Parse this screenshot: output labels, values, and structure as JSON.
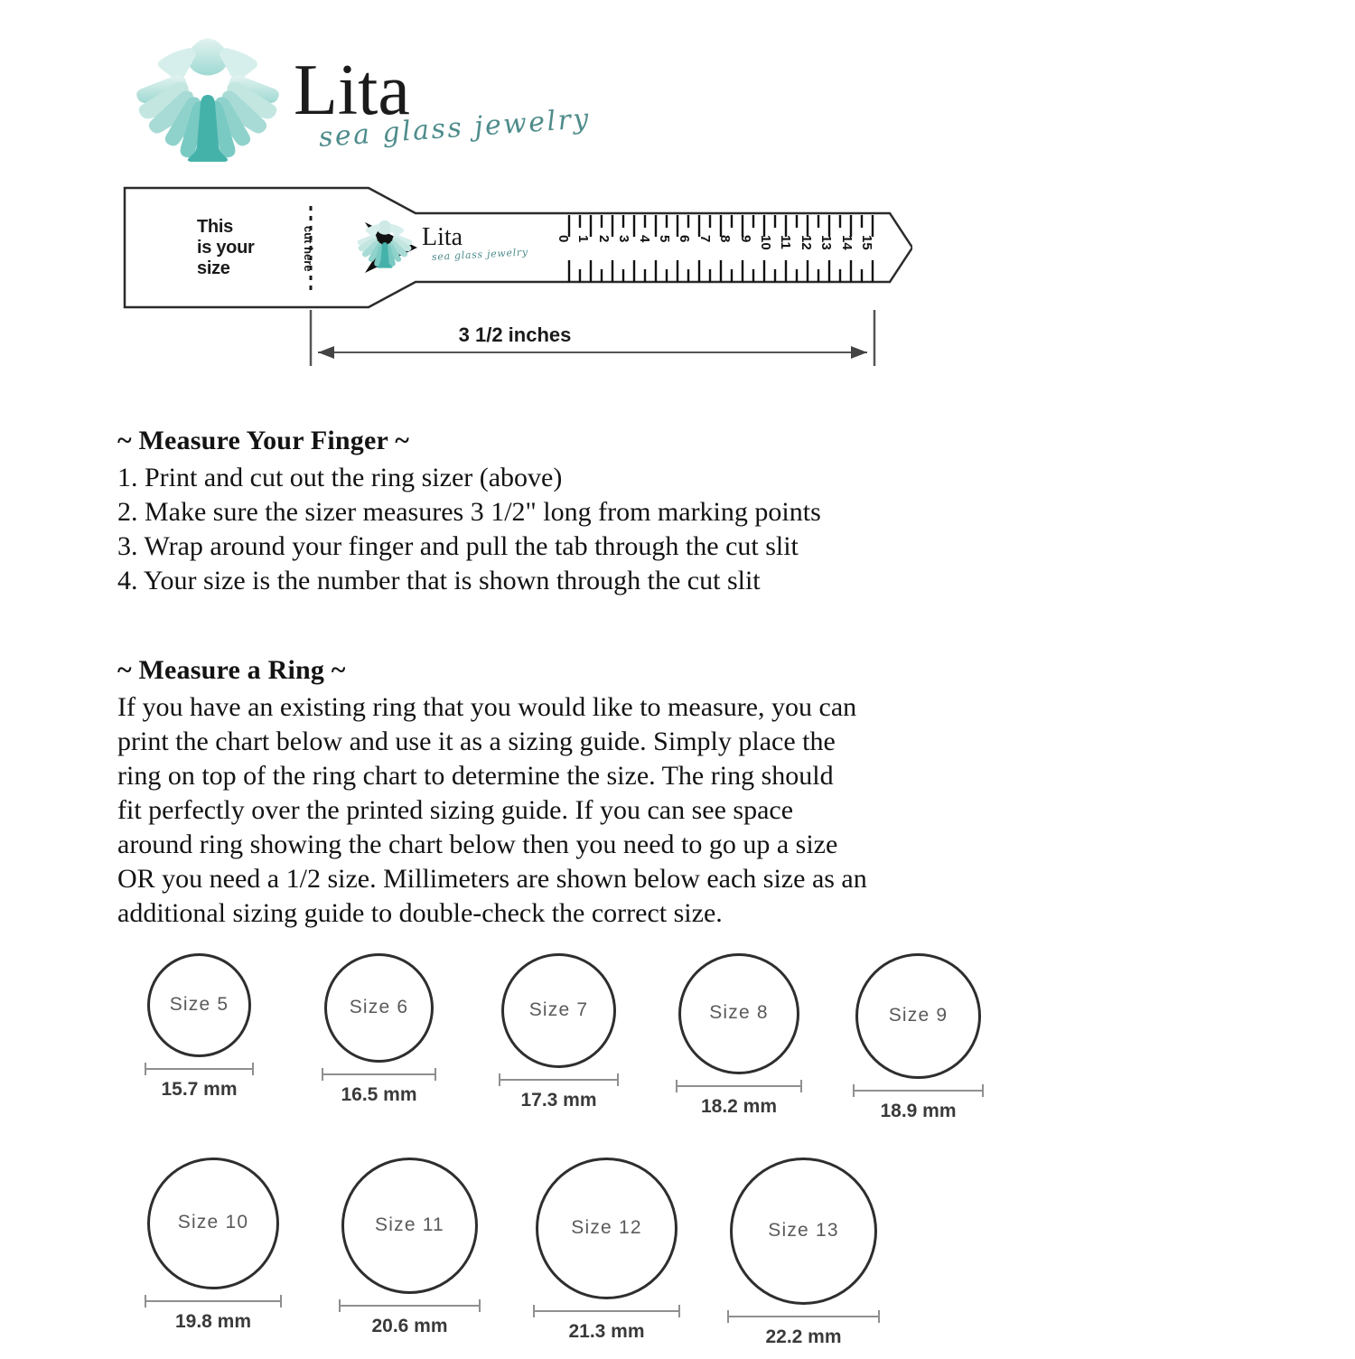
{
  "brand": {
    "name": "Lita",
    "tagline": "sea glass jewelry",
    "logo_icon": "scallop-shell-icon",
    "shell_color_light": "#d9efec",
    "shell_color_mid": "#a9ddd8",
    "shell_color_dark": "#4fb8b0",
    "tagline_color": "#4f8c8c"
  },
  "sizer": {
    "tab_text": "This\nis your\nsize",
    "tab_text_lines": [
      "This",
      "is your",
      "size"
    ],
    "arrow_icon": "chevron-right-icon",
    "cut_here_label": "cut here",
    "brand_name": "Lita",
    "brand_tagline": "sea glass jewelry",
    "ruler_numbers": [
      "0",
      "1",
      "2",
      "3",
      "4",
      "5",
      "6",
      "7",
      "8",
      "9",
      "10",
      "11",
      "12",
      "13",
      "14",
      "15"
    ],
    "length_label": "3 1/2 inches"
  },
  "sections": [
    {
      "id": "finger",
      "heading": "~ Measure Your Finger ~",
      "lines": [
        "1. Print and cut out the ring sizer (above)",
        "2. Make sure the sizer measures 3 1/2\" long from marking points",
        "3. Wrap around your finger and pull the tab through the cut slit",
        "4. Your size is the number that is shown through the cut slit"
      ]
    },
    {
      "id": "ring",
      "heading": "~ Measure a Ring ~",
      "lines": [
        "If you have an existing ring that you would like to measure, you can",
        "print the chart below and use it as a sizing guide.  Simply place the",
        "ring on top of the ring chart to determine the size. The ring should",
        "fit perfectly over the printed sizing guide. If you can see space",
        "around ring showing the chart below then you need to go up a size",
        "OR you need a 1/2 size. Millimeters are shown below each size as an",
        "additional sizing guide to double-check the correct size."
      ]
    }
  ],
  "chart_data": {
    "type": "table",
    "title": "Ring Size Chart",
    "columns": [
      "size_label",
      "diameter_mm"
    ],
    "rows": [
      {
        "size_label": "Size 5",
        "diameter_mm": "15.7 mm",
        "mm": 15.7,
        "row": 1
      },
      {
        "size_label": "Size 6",
        "diameter_mm": "16.5 mm",
        "mm": 16.5,
        "row": 1
      },
      {
        "size_label": "Size 7",
        "diameter_mm": "17.3 mm",
        "mm": 17.3,
        "row": 1
      },
      {
        "size_label": "Size 8",
        "diameter_mm": "18.2 mm",
        "mm": 18.2,
        "row": 1
      },
      {
        "size_label": "Size 9",
        "diameter_mm": "18.9 mm",
        "mm": 18.9,
        "row": 1
      },
      {
        "size_label": "Size 10",
        "diameter_mm": "19.8 mm",
        "mm": 19.8,
        "row": 2
      },
      {
        "size_label": "Size 11",
        "diameter_mm": "20.6 mm",
        "mm": 20.6,
        "row": 2
      },
      {
        "size_label": "Size 12",
        "diameter_mm": "21.3 mm",
        "mm": 21.3,
        "row": 2
      },
      {
        "size_label": "Size 13",
        "diameter_mm": "22.2 mm",
        "mm": 22.2,
        "row": 2
      }
    ]
  }
}
